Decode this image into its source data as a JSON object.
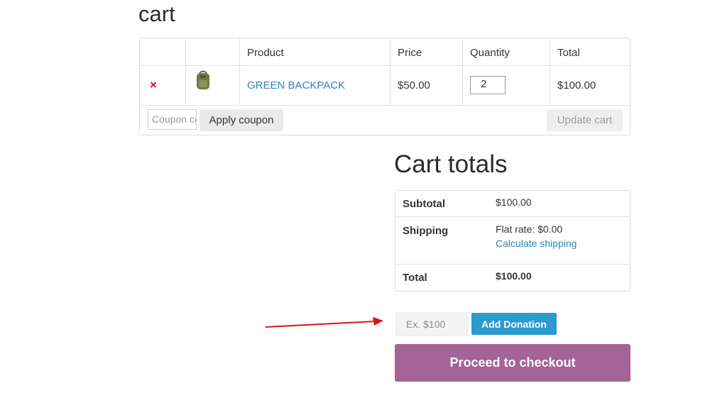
{
  "page": {
    "title": "cart"
  },
  "cart": {
    "headers": [
      "",
      "",
      "Product",
      "Price",
      "Quantity",
      "Total"
    ],
    "row": {
      "remove_icon": "×",
      "product_name": "GREEN BACKPACK",
      "price": "$50.00",
      "quantity": "2",
      "total": "$100.00"
    },
    "coupon_placeholder": "Coupon code",
    "apply_coupon": "Apply coupon",
    "update_cart": "Update cart"
  },
  "totals": {
    "title": "Cart totals",
    "subtotal_label": "Subtotal",
    "subtotal_value": "$100.00",
    "shipping_label": "Shipping",
    "shipping_value": "Flat rate: $0.00",
    "calculate_shipping": "Calculate shipping",
    "total_label": "Total",
    "total_value": "$100.00"
  },
  "donation": {
    "placeholder": "Ex. $100",
    "button": "Add Donation"
  },
  "checkout": {
    "button": "Proceed to checkout"
  },
  "colors": {
    "link": "#2e86b8",
    "donate": "#2b9bd0",
    "checkout": "#a46497",
    "arrow": "#d9141a",
    "remove": "#d9141a"
  },
  "icons": {
    "remove": "remove-icon",
    "thumbnail": "backpack-thumbnail",
    "annotation": "red-arrow"
  }
}
